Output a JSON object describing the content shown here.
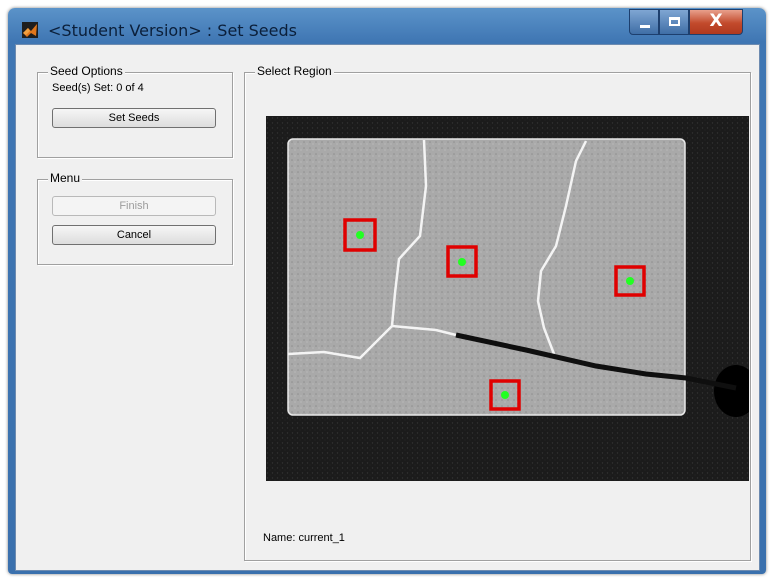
{
  "window": {
    "title": "<Student Version> : Set Seeds",
    "controls": {
      "minimize": "minimize",
      "maximize": "maximize",
      "close": "X"
    }
  },
  "seed_options": {
    "title": "Seed Options",
    "status": "Seed(s) Set: 0 of 4",
    "set_seeds_label": "Set Seeds"
  },
  "menu": {
    "title": "Menu",
    "finish_label": "Finish",
    "cancel_label": "Cancel"
  },
  "select_region": {
    "title": "Select Region",
    "name_text": "Name: current_1",
    "seed_marker_color": "#e00000",
    "seed_point_color": "#22ff22"
  }
}
